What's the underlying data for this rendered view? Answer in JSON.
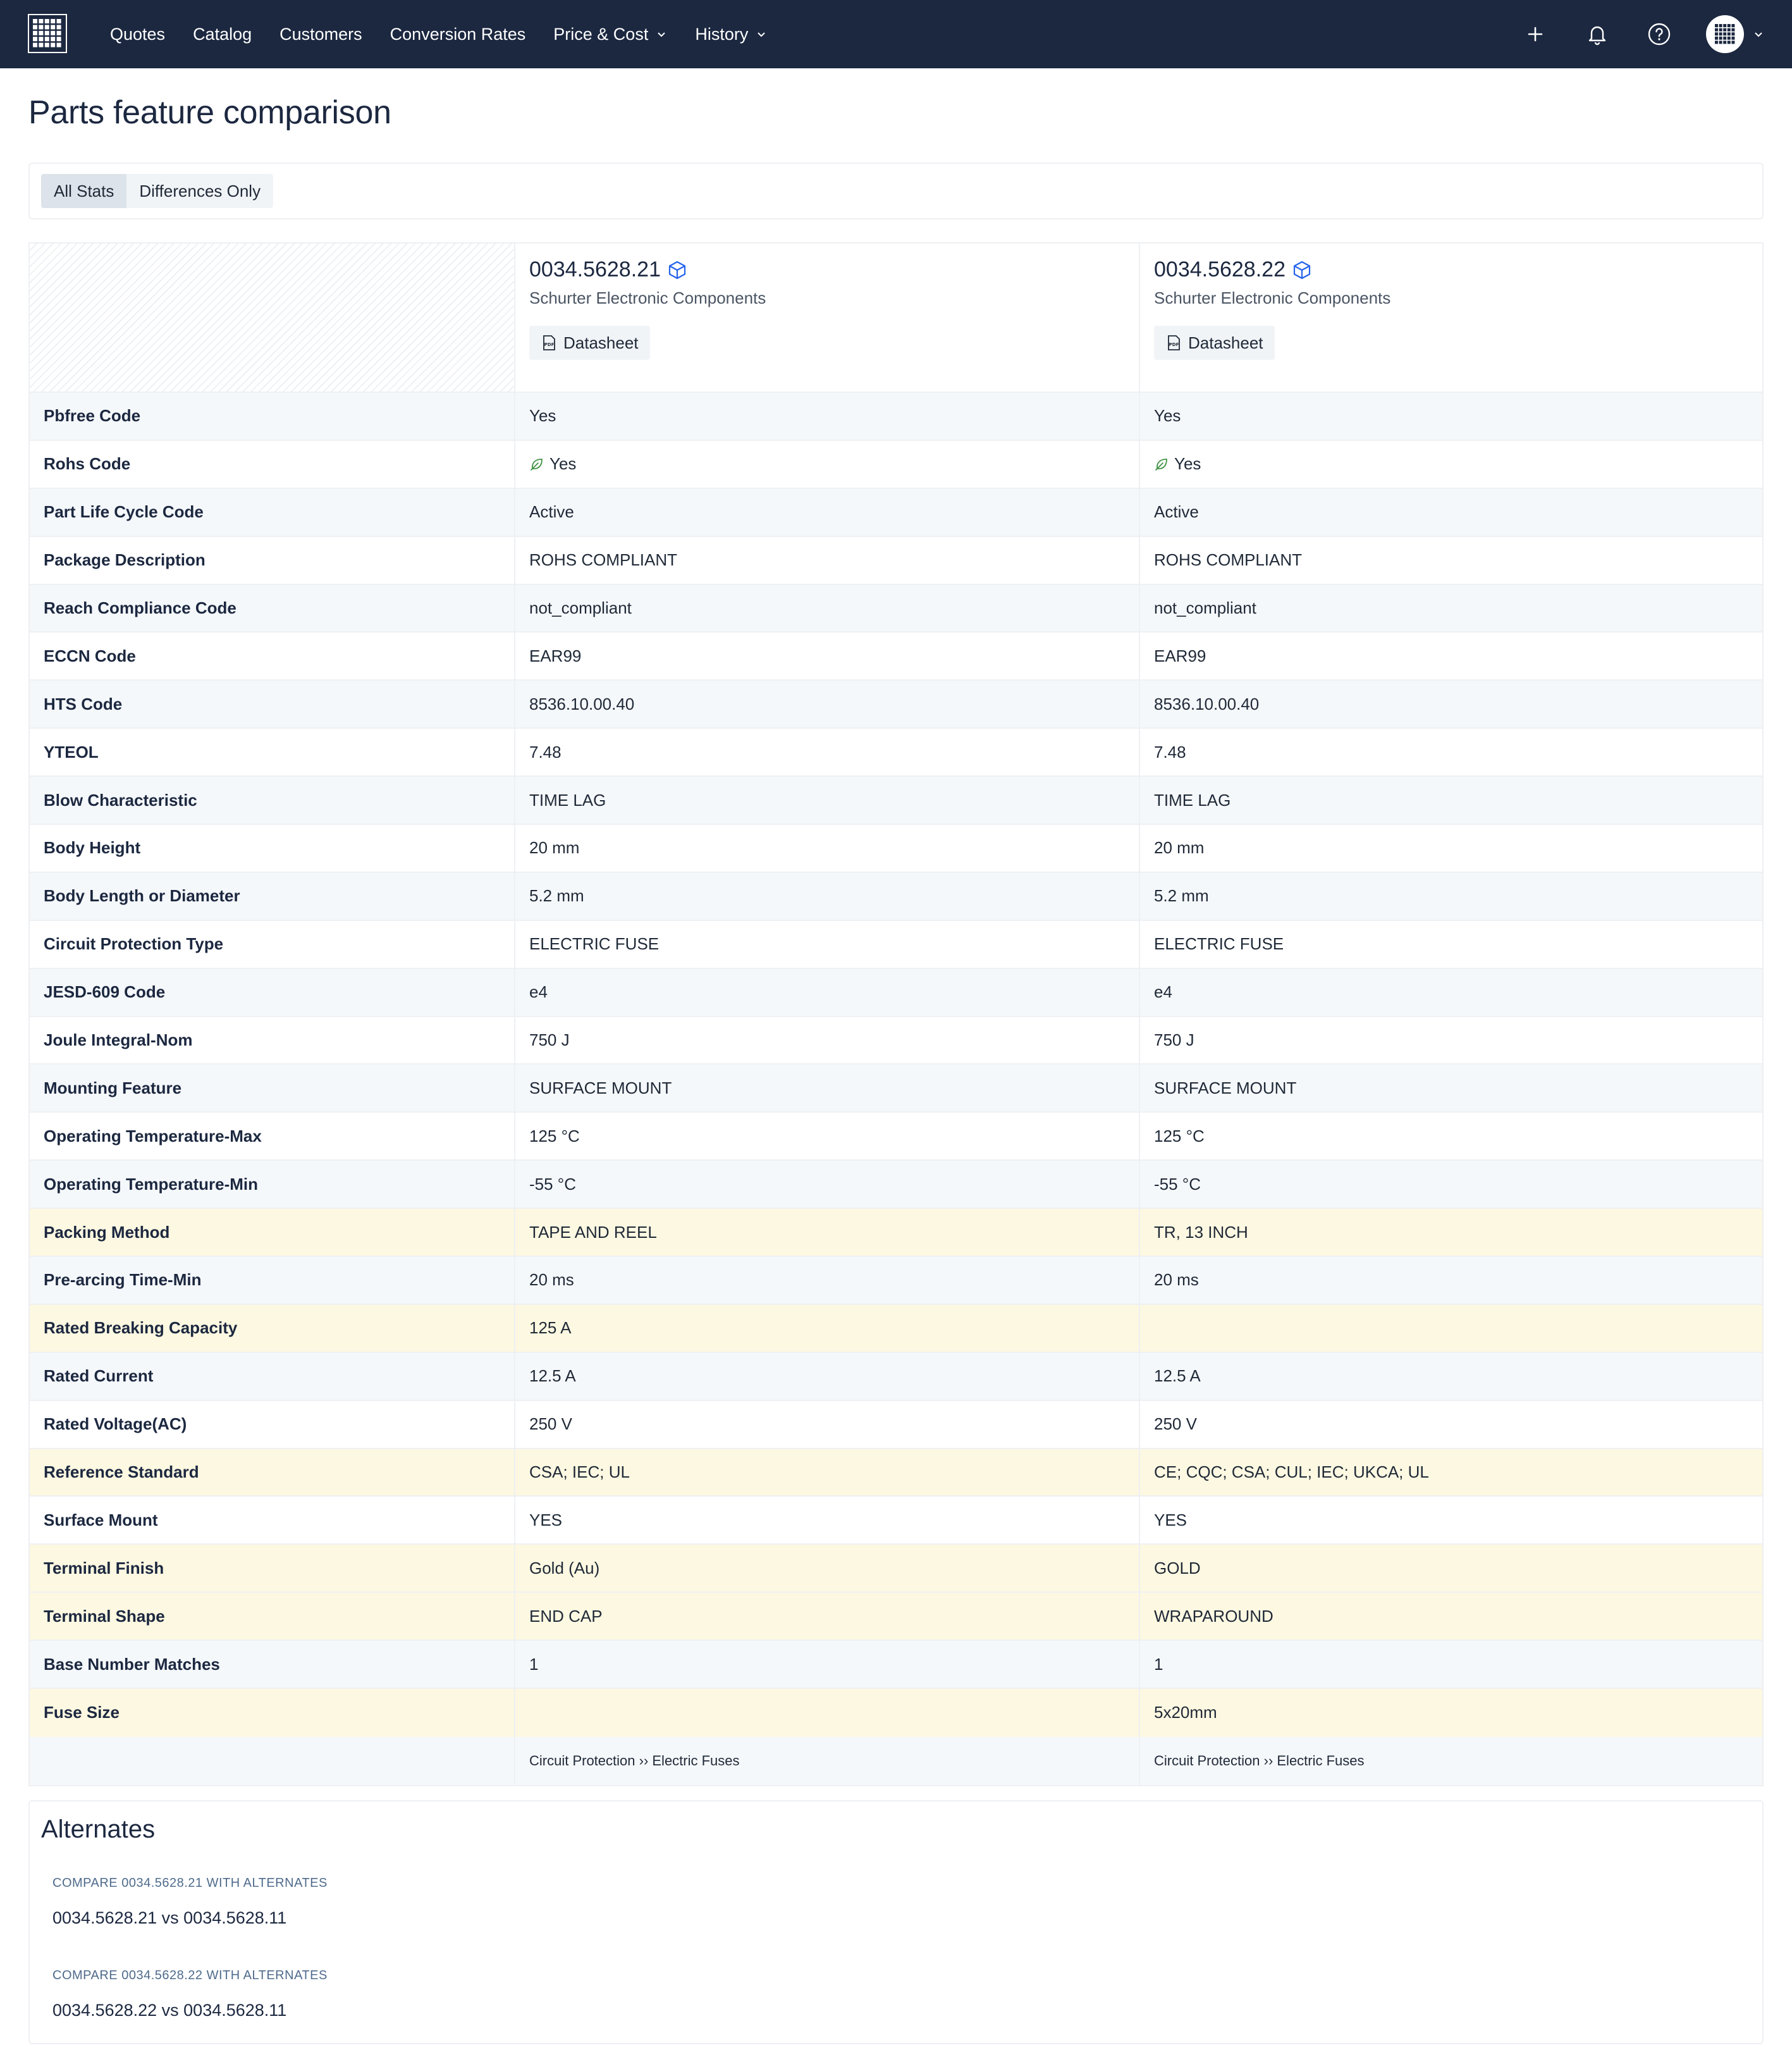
{
  "nav": {
    "items": [
      {
        "label": "Quotes",
        "dropdown": false
      },
      {
        "label": "Catalog",
        "dropdown": false
      },
      {
        "label": "Customers",
        "dropdown": false
      },
      {
        "label": "Conversion Rates",
        "dropdown": false
      },
      {
        "label": "Price & Cost",
        "dropdown": true
      },
      {
        "label": "History",
        "dropdown": true
      }
    ],
    "icons": [
      "plus-icon",
      "bell-icon",
      "help-icon"
    ],
    "colors": {
      "bar": "#1c2840",
      "text": "#ffffff"
    }
  },
  "page": {
    "title": "Parts feature comparison"
  },
  "view_toggle": {
    "options": [
      "All Stats",
      "Differences Only"
    ],
    "selected": "All Stats"
  },
  "parts": [
    {
      "part_number": "0034.5628.21",
      "manufacturer": "Schurter Electronic Components",
      "datasheet_label": "Datasheet",
      "category": "Circuit Protection ›› Electric Fuses"
    },
    {
      "part_number": "0034.5628.22",
      "manufacturer": "Schurter Electronic Components",
      "datasheet_label": "Datasheet",
      "category": "Circuit Protection ›› Electric Fuses"
    }
  ],
  "rows": [
    {
      "label": "Pbfree Code",
      "a": "Yes",
      "b": "Yes",
      "diff": false
    },
    {
      "label": "Rohs Code",
      "a": "Yes",
      "b": "Yes",
      "diff": false,
      "icon": "leaf-icon"
    },
    {
      "label": "Part Life Cycle Code",
      "a": "Active",
      "b": "Active",
      "diff": false
    },
    {
      "label": "Package Description",
      "a": "ROHS COMPLIANT",
      "b": "ROHS COMPLIANT",
      "diff": false
    },
    {
      "label": "Reach Compliance Code",
      "a": "not_compliant",
      "b": "not_compliant",
      "diff": false
    },
    {
      "label": "ECCN Code",
      "a": "EAR99",
      "b": "EAR99",
      "diff": false
    },
    {
      "label": "HTS Code",
      "a": "8536.10.00.40",
      "b": "8536.10.00.40",
      "diff": false
    },
    {
      "label": "YTEOL",
      "a": "7.48",
      "b": "7.48",
      "diff": false
    },
    {
      "label": "Blow Characteristic",
      "a": "TIME LAG",
      "b": "TIME LAG",
      "diff": false
    },
    {
      "label": "Body Height",
      "a": "20 mm",
      "b": "20 mm",
      "diff": false
    },
    {
      "label": "Body Length or Diameter",
      "a": "5.2 mm",
      "b": "5.2 mm",
      "diff": false
    },
    {
      "label": "Circuit Protection Type",
      "a": "ELECTRIC FUSE",
      "b": "ELECTRIC FUSE",
      "diff": false
    },
    {
      "label": "JESD-609 Code",
      "a": "e4",
      "b": "e4",
      "diff": false
    },
    {
      "label": "Joule Integral-Nom",
      "a": "750 J",
      "b": "750 J",
      "diff": false
    },
    {
      "label": "Mounting Feature",
      "a": "SURFACE MOUNT",
      "b": "SURFACE MOUNT",
      "diff": false
    },
    {
      "label": "Operating Temperature-Max",
      "a": "125 °C",
      "b": "125 °C",
      "diff": false
    },
    {
      "label": "Operating Temperature-Min",
      "a": "-55 °C",
      "b": "-55 °C",
      "diff": false
    },
    {
      "label": "Packing Method",
      "a": "TAPE AND REEL",
      "b": "TR, 13 INCH",
      "diff": true
    },
    {
      "label": "Pre-arcing Time-Min",
      "a": "20 ms",
      "b": "20 ms",
      "diff": false
    },
    {
      "label": "Rated Breaking Capacity",
      "a": "125 A",
      "b": "",
      "diff": true
    },
    {
      "label": "Rated Current",
      "a": "12.5 A",
      "b": "12.5 A",
      "diff": false
    },
    {
      "label": "Rated Voltage(AC)",
      "a": "250 V",
      "b": "250 V",
      "diff": false
    },
    {
      "label": "Reference Standard",
      "a": "CSA; IEC; UL",
      "b": "CE; CQC; CSA; CUL; IEC; UKCA; UL",
      "diff": true
    },
    {
      "label": "Surface Mount",
      "a": "YES",
      "b": "YES",
      "diff": false
    },
    {
      "label": "Terminal Finish",
      "a": "Gold (Au)",
      "b": "GOLD",
      "diff": true
    },
    {
      "label": "Terminal Shape",
      "a": "END CAP",
      "b": "WRAPAROUND",
      "diff": true
    },
    {
      "label": "Base Number Matches",
      "a": "1",
      "b": "1",
      "diff": false
    },
    {
      "label": "Fuse Size",
      "a": "",
      "b": "5x20mm",
      "diff": true
    }
  ],
  "alternates": {
    "title": "Alternates",
    "groups": [
      {
        "heading": "COMPARE 0034.5628.21 WITH ALTERNATES",
        "link": "0034.5628.21 vs 0034.5628.11"
      },
      {
        "heading": "COMPARE 0034.5628.22 WITH ALTERNATES",
        "link": "0034.5628.22 vs 0034.5628.11"
      }
    ]
  },
  "colors": {
    "diff_row": "#fdf8e1",
    "alt_row": "#f5f8fb",
    "accent_icon": "#2563eb",
    "leaf": "#3f9142"
  }
}
